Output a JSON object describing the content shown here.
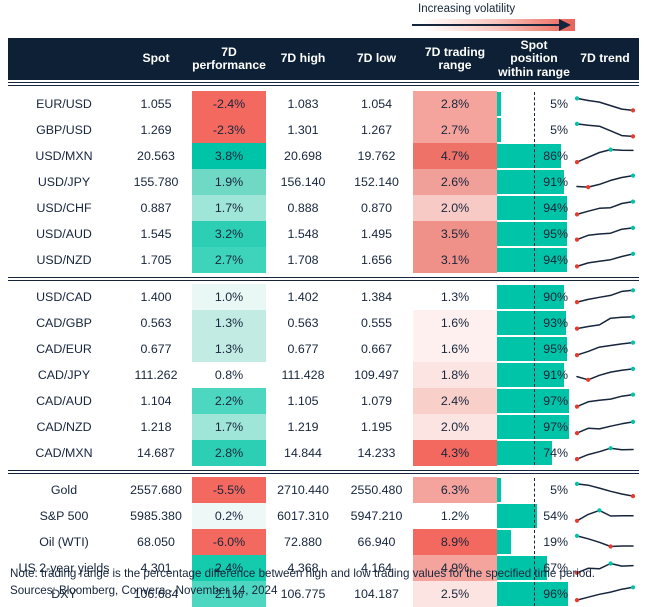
{
  "legend": {
    "label": "Increasing volatility",
    "arrow_name": "volatility-gradient-arrow"
  },
  "header": {
    "name": "",
    "spot": "Spot",
    "performance_line1": "7D",
    "performance_line2": "performance",
    "high": "7D high",
    "low": "7D low",
    "range_line1": "7D trading",
    "range_line2": "range",
    "position_line1": "Spot position",
    "position_line2": "within range",
    "trend": "7D trend"
  },
  "colors": {
    "header_bg": "#0d2035",
    "text": "#16253c",
    "teal": "#00c4a7",
    "red": "#f4695f",
    "spark_line": "#16253c",
    "spark_high_dot": "#00c4a7",
    "spark_low_dot": "#e8392c"
  },
  "footnotes": {
    "note": "Note: trading range is the percentage difference between high and low trading values for the specified time period.",
    "sources": "Sources: Bloomberg, Convera - November 14, 2024"
  },
  "chart_data": {
    "type": "table",
    "title": "",
    "columns": [
      "",
      "Spot",
      "7D performance",
      "7D high",
      "7D low",
      "7D trading range",
      "Spot position within range",
      "7D trend"
    ],
    "sections": [
      {
        "rows": [
          {
            "name": "EUR/USD",
            "spot": "1.055",
            "perf": "-2.4%",
            "perf_val": -2.4,
            "perf_bg": "#f4695f",
            "high": "1.083",
            "low": "1.054",
            "range": "2.8%",
            "range_val": 2.8,
            "range_bg": "#f4a49d",
            "pos": "5%",
            "pos_val": 5,
            "trend": [
              0.85,
              0.72,
              0.62,
              0.4,
              0.18,
              0.1
            ],
            "high_idx": 0,
            "low_idx": 5
          },
          {
            "name": "GBP/USD",
            "spot": "1.269",
            "perf": "-2.3%",
            "perf_val": -2.3,
            "perf_bg": "#f4695f",
            "high": "1.301",
            "low": "1.267",
            "range": "2.7%",
            "range_val": 2.7,
            "range_bg": "#f4a49d",
            "pos": "5%",
            "pos_val": 5,
            "trend": [
              0.88,
              0.8,
              0.74,
              0.45,
              0.15,
              0.1
            ],
            "high_idx": 0,
            "low_idx": 5
          },
          {
            "name": "USD/MXN",
            "spot": "20.563",
            "perf": "3.8%",
            "perf_val": 3.8,
            "perf_bg": "#00c4a7",
            "high": "20.698",
            "low": "19.762",
            "range": "4.7%",
            "range_val": 4.7,
            "range_bg": "#ee7268",
            "pos": "86%",
            "pos_val": 86,
            "trend": [
              0.12,
              0.42,
              0.72,
              0.9,
              0.86,
              0.85
            ],
            "high_idx": 3,
            "low_idx": 0
          },
          {
            "name": "USD/JPY",
            "spot": "155.780",
            "perf": "1.9%",
            "perf_val": 1.9,
            "perf_bg": "#6fd9c6",
            "high": "156.140",
            "low": "152.140",
            "range": "2.6%",
            "range_val": 2.6,
            "range_bg": "#f0a099",
            "pos": "91%",
            "pos_val": 91,
            "trend": [
              0.22,
              0.18,
              0.35,
              0.6,
              0.78,
              0.9
            ],
            "high_idx": 5,
            "low_idx": 1
          },
          {
            "name": "USD/CHF",
            "spot": "0.887",
            "perf": "1.7%",
            "perf_val": 1.7,
            "perf_bg": "#9fe5d8",
            "high": "0.888",
            "low": "0.870",
            "range": "2.0%",
            "range_val": 2.0,
            "range_bg": "#f7cac5",
            "pos": "94%",
            "pos_val": 94,
            "trend": [
              0.1,
              0.3,
              0.48,
              0.52,
              0.78,
              0.9
            ],
            "high_idx": 5,
            "low_idx": 0
          },
          {
            "name": "USD/AUD",
            "spot": "1.545",
            "perf": "3.2%",
            "perf_val": 3.2,
            "perf_bg": "#2ccfb4",
            "high": "1.548",
            "low": "1.495",
            "range": "3.5%",
            "range_val": 3.5,
            "range_bg": "#f09189",
            "pos": "95%",
            "pos_val": 95,
            "trend": [
              0.15,
              0.42,
              0.5,
              0.55,
              0.8,
              0.88
            ],
            "high_idx": 5,
            "low_idx": 0
          },
          {
            "name": "USD/NZD",
            "spot": "1.705",
            "perf": "2.7%",
            "perf_val": 2.7,
            "perf_bg": "#3ed4bb",
            "high": "1.708",
            "low": "1.656",
            "range": "3.1%",
            "range_val": 3.1,
            "range_bg": "#f09189",
            "pos": "94%",
            "pos_val": 94,
            "trend": [
              0.1,
              0.32,
              0.42,
              0.52,
              0.72,
              0.88
            ],
            "high_idx": 5,
            "low_idx": 0
          }
        ]
      },
      {
        "rows": [
          {
            "name": "USD/CAD",
            "spot": "1.400",
            "perf": "1.0%",
            "perf_val": 1.0,
            "perf_bg": "#e9f8f4",
            "high": "1.402",
            "low": "1.384",
            "range": "1.3%",
            "range_val": 1.3,
            "range_bg": "#ffffff",
            "pos": "90%",
            "pos_val": 90,
            "trend": [
              0.18,
              0.35,
              0.48,
              0.6,
              0.85,
              0.92
            ],
            "high_idx": 5,
            "low_idx": 0
          },
          {
            "name": "CAD/GBP",
            "spot": "0.563",
            "perf": "1.3%",
            "perf_val": 1.3,
            "perf_bg": "#c2ece3",
            "high": "0.563",
            "low": "0.555",
            "range": "1.6%",
            "range_val": 1.6,
            "range_bg": "#fdf0ee",
            "pos": "93%",
            "pos_val": 93,
            "trend": [
              0.15,
              0.28,
              0.38,
              0.8,
              0.86,
              0.88
            ],
            "high_idx": 5,
            "low_idx": 0
          },
          {
            "name": "CAD/EUR",
            "spot": "0.677",
            "perf": "1.3%",
            "perf_val": 1.3,
            "perf_bg": "#c2ece3",
            "high": "0.677",
            "low": "0.667",
            "range": "1.6%",
            "range_val": 1.6,
            "range_bg": "#fdf0ee",
            "pos": "95%",
            "pos_val": 95,
            "trend": [
              0.12,
              0.35,
              0.62,
              0.72,
              0.82,
              0.9
            ],
            "high_idx": 5,
            "low_idx": 0
          },
          {
            "name": "CAD/JPY",
            "spot": "111.262",
            "perf": "0.8%",
            "perf_val": 0.8,
            "perf_bg": "#ffffff",
            "high": "111.428",
            "low": "109.497",
            "range": "1.8%",
            "range_val": 1.8,
            "range_bg": "#fbe4e1",
            "pos": "91%",
            "pos_val": 91,
            "trend": [
              0.4,
              0.2,
              0.48,
              0.68,
              0.8,
              0.88
            ],
            "high_idx": 5,
            "low_idx": 1
          },
          {
            "name": "CAD/AUD",
            "spot": "1.104",
            "perf": "2.2%",
            "perf_val": 2.2,
            "perf_bg": "#4ed7c0",
            "high": "1.105",
            "low": "1.079",
            "range": "2.4%",
            "range_val": 2.4,
            "range_bg": "#f9cfca",
            "pos": "97%",
            "pos_val": 97,
            "trend": [
              0.15,
              0.45,
              0.55,
              0.62,
              0.8,
              0.9
            ],
            "high_idx": 5,
            "low_idx": 0
          },
          {
            "name": "CAD/NZD",
            "spot": "1.218",
            "perf": "1.7%",
            "perf_val": 1.7,
            "perf_bg": "#9fe5d8",
            "high": "1.219",
            "low": "1.195",
            "range": "2.0%",
            "range_val": 2.0,
            "range_bg": "#fbe4e1",
            "pos": "97%",
            "pos_val": 97,
            "trend": [
              0.12,
              0.42,
              0.38,
              0.55,
              0.7,
              0.82
            ],
            "high_idx": 5,
            "low_idx": 0
          },
          {
            "name": "CAD/MXN",
            "spot": "14.687",
            "perf": "2.8%",
            "perf_val": 2.8,
            "perf_bg": "#2ccfb4",
            "high": "14.844",
            "low": "14.233",
            "range": "4.3%",
            "range_val": 4.3,
            "range_bg": "#f4695f",
            "pos": "74%",
            "pos_val": 74,
            "trend": [
              0.12,
              0.4,
              0.58,
              0.8,
              0.7,
              0.72
            ],
            "high_idx": 3,
            "low_idx": 0
          }
        ]
      },
      {
        "rows": [
          {
            "name": "Gold",
            "spot": "2557.680",
            "perf": "-5.5%",
            "perf_val": -5.5,
            "perf_bg": "#f4695f",
            "high": "2710.440",
            "low": "2550.480",
            "range": "6.3%",
            "range_val": 6.3,
            "range_bg": "#f4a49d",
            "pos": "5%",
            "pos_val": 5,
            "trend": [
              0.88,
              0.8,
              0.62,
              0.42,
              0.25,
              0.12
            ],
            "high_idx": 0,
            "low_idx": 5
          },
          {
            "name": "S&P 500",
            "spot": "5985.380",
            "perf": "0.2%",
            "perf_val": 0.2,
            "perf_bg": "#eef9f7",
            "high": "6017.310",
            "low": "5947.210",
            "range": "1.2%",
            "range_val": 1.2,
            "range_bg": "#ffffff",
            "pos": "54%",
            "pos_val": 54,
            "trend": [
              0.2,
              0.6,
              0.85,
              0.5,
              0.52,
              0.52
            ],
            "high_idx": 2,
            "low_idx": 0
          },
          {
            "name": "Oil (WTI)",
            "spot": "68.050",
            "perf": "-6.0%",
            "perf_val": -6.0,
            "perf_bg": "#f4695f",
            "high": "72.880",
            "low": "66.940",
            "range": "8.9%",
            "range_val": 8.9,
            "range_bg": "#f4695f",
            "pos": "19%",
            "pos_val": 19,
            "trend": [
              0.88,
              0.7,
              0.48,
              0.22,
              0.25,
              0.25
            ],
            "high_idx": 0,
            "low_idx": 3
          },
          {
            "name": "US 2-year yields",
            "spot": "4.301",
            "perf": "2.4%",
            "perf_val": 2.4,
            "perf_bg": "#14cbae",
            "high": "4.368",
            "low": "4.164",
            "range": "4.9%",
            "range_val": 4.9,
            "range_bg": "#f4a49d",
            "pos": "67%",
            "pos_val": 67,
            "trend": [
              0.2,
              0.48,
              0.45,
              0.78,
              0.62,
              0.65
            ],
            "high_idx": 3,
            "low_idx": 0
          },
          {
            "name": "DXY",
            "spot": "106.684",
            "perf": "2.1%",
            "perf_val": 2.1,
            "perf_bg": "#4ed7c0",
            "high": "106.775",
            "low": "104.187",
            "range": "2.5%",
            "range_val": 2.5,
            "range_bg": "#fbe4e1",
            "pos": "96%",
            "pos_val": 96,
            "trend": [
              0.12,
              0.3,
              0.48,
              0.62,
              0.8,
              0.92
            ],
            "high_idx": 5,
            "low_idx": 0
          }
        ]
      }
    ]
  }
}
